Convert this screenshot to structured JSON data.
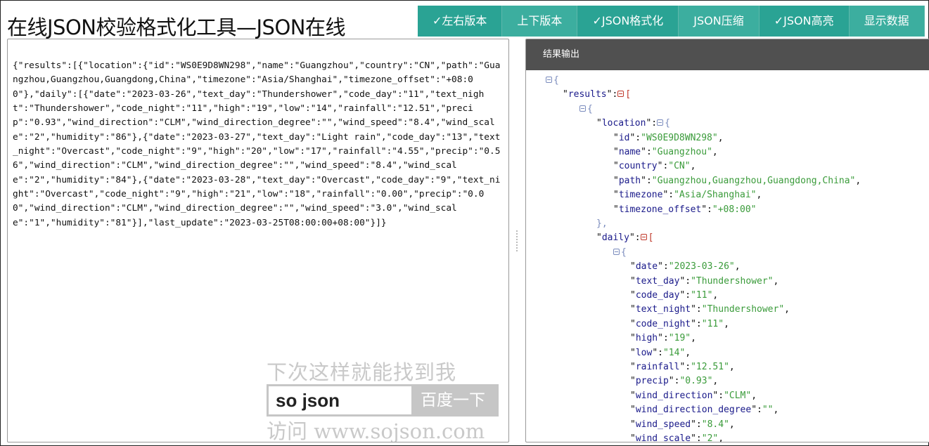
{
  "page": {
    "title": "在线JSON校验格式化工具—JSON在线"
  },
  "toolbar": {
    "buttons": [
      {
        "label": "✓左右版本",
        "active": true
      },
      {
        "label": "上下版本",
        "active": false
      },
      {
        "label": "✓JSON格式化",
        "active": true
      },
      {
        "label": "JSON压缩",
        "active": false
      },
      {
        "label": "✓JSON高亮",
        "active": true
      },
      {
        "label": "显示数据",
        "active": false
      }
    ],
    "colors": {
      "active": "#2aa394",
      "plain": "#3cae9f"
    }
  },
  "input": {
    "raw_json": "{\"results\":[{\"location\":{\"id\":\"WS0E9D8WN298\",\"name\":\"Guangzhou\",\"country\":\"CN\",\"path\":\"Guangzhou,Guangzhou,Guangdong,China\",\"timezone\":\"Asia/Shanghai\",\"timezone_offset\":\"+08:00\"},\"daily\":[{\"date\":\"2023-03-26\",\"text_day\":\"Thundershower\",\"code_day\":\"11\",\"text_night\":\"Thundershower\",\"code_night\":\"11\",\"high\":\"19\",\"low\":\"14\",\"rainfall\":\"12.51\",\"precip\":\"0.93\",\"wind_direction\":\"CLM\",\"wind_direction_degree\":\"\",\"wind_speed\":\"8.4\",\"wind_scale\":\"2\",\"humidity\":\"86\"},{\"date\":\"2023-03-27\",\"text_day\":\"Light rain\",\"code_day\":\"13\",\"text_night\":\"Overcast\",\"code_night\":\"9\",\"high\":\"20\",\"low\":\"17\",\"rainfall\":\"4.55\",\"precip\":\"0.56\",\"wind_direction\":\"CLM\",\"wind_direction_degree\":\"\",\"wind_speed\":\"8.4\",\"wind_scale\":\"2\",\"humidity\":\"84\"},{\"date\":\"2023-03-28\",\"text_day\":\"Overcast\",\"code_day\":\"9\",\"text_night\":\"Overcast\",\"code_night\":\"9\",\"high\":\"21\",\"low\":\"18\",\"rainfall\":\"0.00\",\"precip\":\"0.00\",\"wind_direction\":\"CLM\",\"wind_direction_degree\":\"\",\"wind_speed\":\"3.0\",\"wind_scale\":\"1\",\"humidity\":\"81\"}],\"last_update\":\"2023-03-25T08:00:00+08:00\"}]}"
  },
  "watermark": {
    "line1": "下次这样就能找到我",
    "search_text": "so json",
    "search_button": "百度一下",
    "line2": "访问 www.sojson.com"
  },
  "output": {
    "header": "结果输出",
    "lines": [
      {
        "indent": 0,
        "toggle": "blue",
        "open": "{"
      },
      {
        "indent": 1,
        "key": "results",
        "toggle": "red",
        "open": "["
      },
      {
        "indent": 2,
        "toggle": "blue",
        "open": "{"
      },
      {
        "indent": 3,
        "key": "location",
        "toggle": "blue",
        "open": "{"
      },
      {
        "indent": 4,
        "key": "id",
        "value": "\"WS0E9D8WN298\"",
        "comma": true
      },
      {
        "indent": 4,
        "key": "name",
        "value": "\"Guangzhou\"",
        "comma": true
      },
      {
        "indent": 4,
        "key": "country",
        "value": "\"CN\"",
        "comma": true
      },
      {
        "indent": 4,
        "key": "path",
        "value": "\"Guangzhou,Guangzhou,Guangdong,China\"",
        "comma": true
      },
      {
        "indent": 4,
        "key": "timezone",
        "value": "\"Asia/Shanghai\"",
        "comma": true
      },
      {
        "indent": 4,
        "key": "timezone_offset",
        "value": "\"+08:00\"",
        "comma": false
      },
      {
        "indent": 3,
        "close": "},"
      },
      {
        "indent": 3,
        "key": "daily",
        "toggle": "red",
        "open": "["
      },
      {
        "indent": 4,
        "toggle": "blue",
        "open": "{"
      },
      {
        "indent": 5,
        "key": "date",
        "value": "\"2023-03-26\"",
        "comma": true
      },
      {
        "indent": 5,
        "key": "text_day",
        "value": "\"Thundershower\"",
        "comma": true
      },
      {
        "indent": 5,
        "key": "code_day",
        "value": "\"11\"",
        "comma": true
      },
      {
        "indent": 5,
        "key": "text_night",
        "value": "\"Thundershower\"",
        "comma": true
      },
      {
        "indent": 5,
        "key": "code_night",
        "value": "\"11\"",
        "comma": true
      },
      {
        "indent": 5,
        "key": "high",
        "value": "\"19\"",
        "comma": true
      },
      {
        "indent": 5,
        "key": "low",
        "value": "\"14\"",
        "comma": true
      },
      {
        "indent": 5,
        "key": "rainfall",
        "value": "\"12.51\"",
        "comma": true
      },
      {
        "indent": 5,
        "key": "precip",
        "value": "\"0.93\"",
        "comma": true
      },
      {
        "indent": 5,
        "key": "wind_direction",
        "value": "\"CLM\"",
        "comma": true
      },
      {
        "indent": 5,
        "key": "wind_direction_degree",
        "value": "\"\"",
        "comma": true
      },
      {
        "indent": 5,
        "key": "wind_speed",
        "value": "\"8.4\"",
        "comma": true
      },
      {
        "indent": 5,
        "key": "wind_scale",
        "value": "\"2\"",
        "comma": true
      }
    ]
  }
}
